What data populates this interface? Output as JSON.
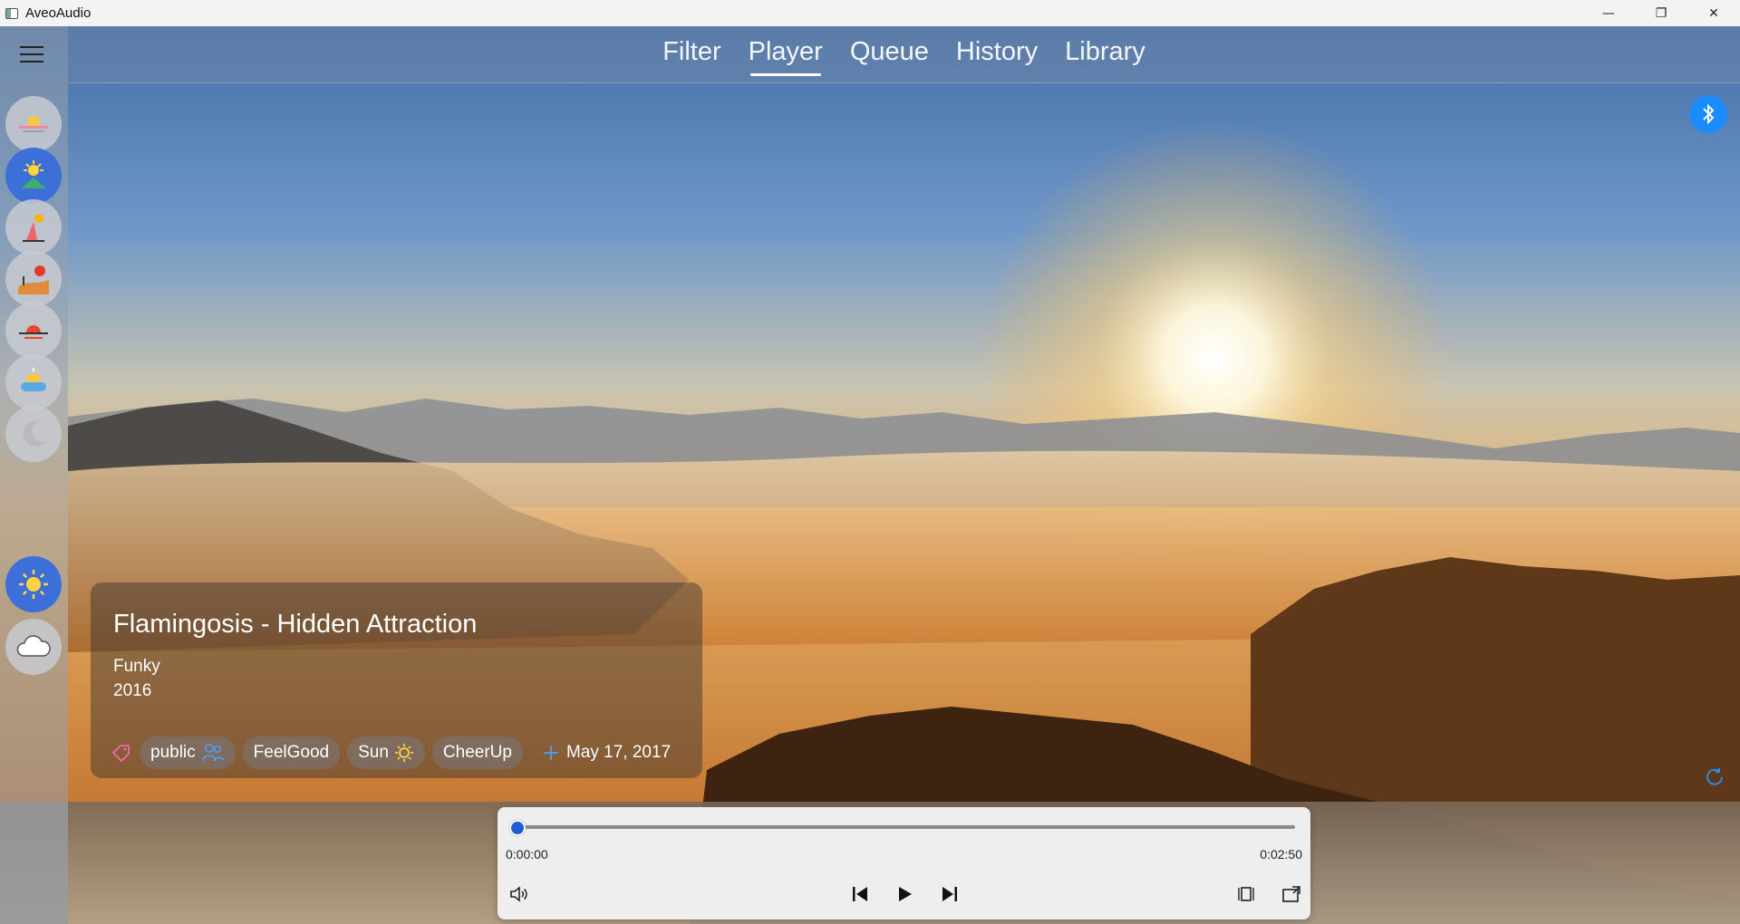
{
  "window": {
    "title": "AveoAudio",
    "minimize": "—",
    "maximize": "❐",
    "close": "✕"
  },
  "nav": {
    "tabs": [
      "Filter",
      "Player",
      "Queue",
      "History",
      "Library"
    ],
    "active": "Player"
  },
  "song": {
    "title": "Flamingosis - Hidden Attraction",
    "genre": "Funky",
    "year": "2016"
  },
  "tags": [
    {
      "label": "public",
      "icon": "people-icon"
    },
    {
      "label": "FeelGood"
    },
    {
      "label": "Sun",
      "icon": "sun-icon"
    },
    {
      "label": "CheerUp"
    }
  ],
  "added_date": "May 17, 2017",
  "player": {
    "current_time": "0:00:00",
    "total_time": "0:02:50",
    "progress": 0
  },
  "rail": {
    "time_of_day": [
      "dawn-icon",
      "morning-icon",
      "day-icon",
      "afternoon-icon",
      "sunset-icon",
      "evening-icon",
      "night-icon"
    ],
    "weather": [
      "sun-icon",
      "cloud-icon"
    ],
    "active_time_of_day": "morning-icon",
    "active_weather": "sun-icon"
  },
  "colors": {
    "accent": "#3d6fd9",
    "bluetooth": "#1a8cff",
    "slider_thumb": "#1f5bd6"
  }
}
